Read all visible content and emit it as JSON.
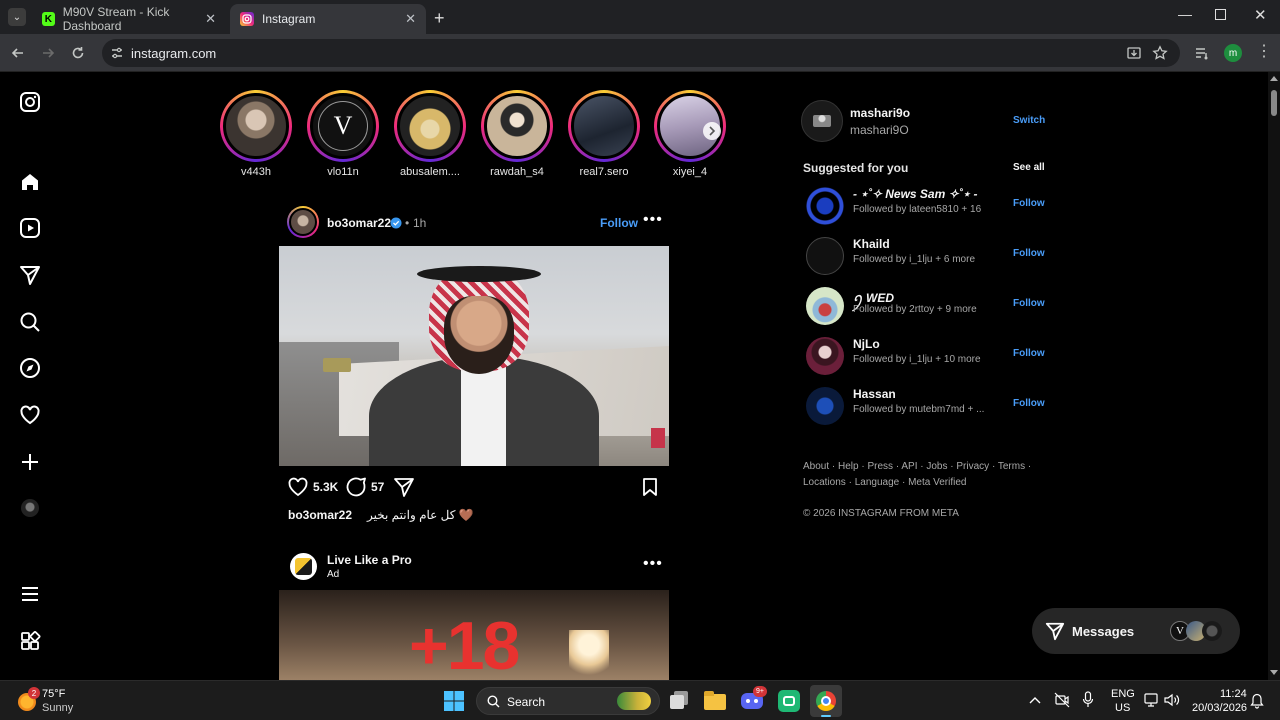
{
  "browser": {
    "tabs": [
      {
        "title": "M90V Stream - Kick Dashboard",
        "favicon": "K"
      },
      {
        "title": "Instagram",
        "favicon": "instagram-icon"
      }
    ],
    "url": "instagram.com"
  },
  "stories": [
    {
      "username": "v443h"
    },
    {
      "username": "vlo11n",
      "avatar_letter": "V"
    },
    {
      "username": "abusalem...."
    },
    {
      "username": "rawdah_s4"
    },
    {
      "username": "real7.sero"
    },
    {
      "username": "xiyei_4"
    }
  ],
  "post": {
    "username": "bo3omar22",
    "time": "1h",
    "follow_label": "Follow",
    "likes": "5.3K",
    "comments": "57",
    "caption_user": "bo3omar22",
    "caption_text": "كل عام وانتم بخير 🤎"
  },
  "ad": {
    "name": "Live Like a Pro",
    "label": "Ad",
    "image_text": "+18"
  },
  "profile": {
    "username": "mashari9o",
    "fullname": "mashari9O",
    "switch_label": "Switch"
  },
  "suggested": {
    "title": "Suggested for you",
    "see_all": "See all",
    "follow_label": "Follow",
    "items": [
      {
        "name": "- ⋆˚✧ News Sam ✧˚⋆ -",
        "sub": "Followed by lateen5810 + 16"
      },
      {
        "name": "Khaild",
        "sub": "Followed by i_1lju + 6 more"
      },
      {
        "name": "ꪆ WED",
        "sub": "Followed by 2rttoy + 9 more"
      },
      {
        "name": "NjLo",
        "sub": "Followed by i_1lju + 10 more"
      },
      {
        "name": "Hassan",
        "sub": "Followed by mutebm7md + ..."
      }
    ]
  },
  "footer": {
    "links_line1": "About · Help · Press · API · Jobs · Privacy · Terms ·",
    "links_line2": "Locations · Language · Meta Verified",
    "copyright": "© 2026 INSTAGRAM FROM META"
  },
  "messages_label": "Messages",
  "taskbar": {
    "weather_temp": "75°F",
    "weather_desc": "Sunny",
    "search_placeholder": "Search",
    "lang1": "ENG",
    "lang2": "US",
    "time": "11:24",
    "date": "20/03/2026",
    "discord_badge": "9+",
    "weather_badge": "2"
  }
}
